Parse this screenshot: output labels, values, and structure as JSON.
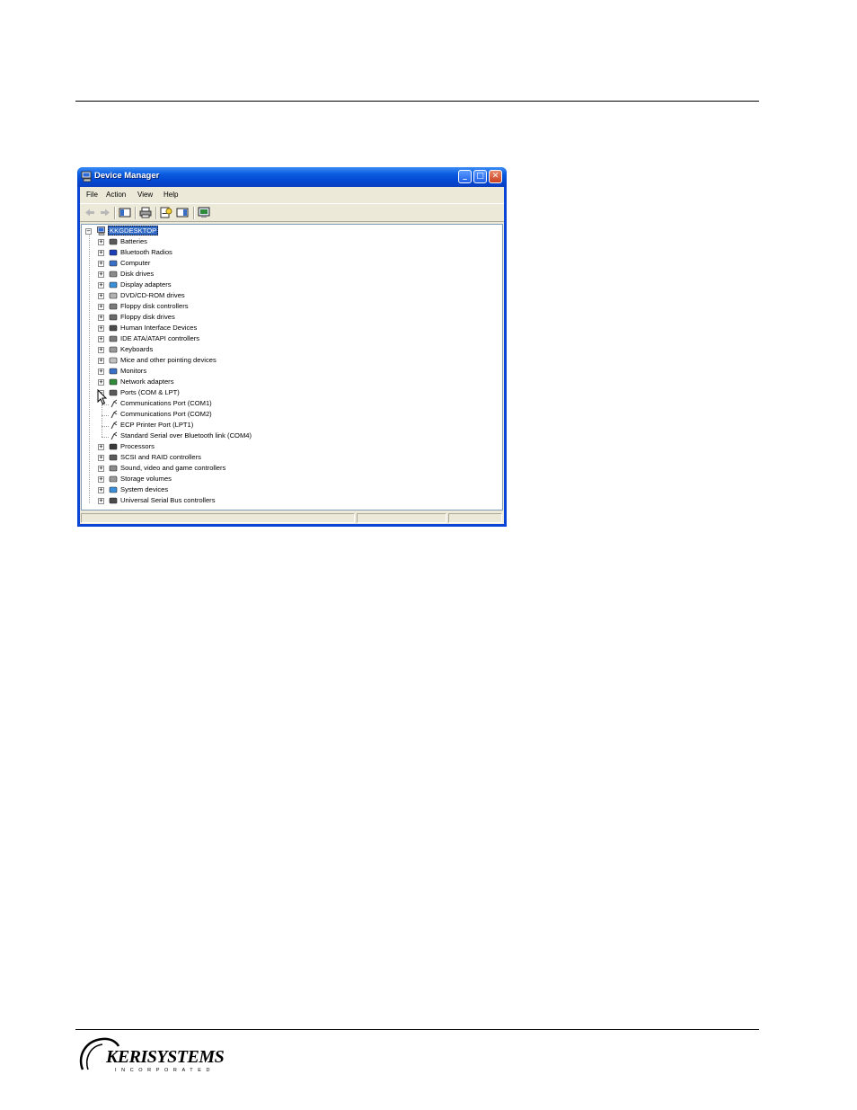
{
  "window": {
    "title": "Device Manager",
    "buttons": {
      "minimize": "_",
      "maximize": "□",
      "close": "✕"
    },
    "menu": [
      "File",
      "Action",
      "View",
      "Help"
    ],
    "toolbar_icons": [
      "back-arrow-icon",
      "forward-arrow-icon",
      "console-tree-icon",
      "print-icon",
      "properties-icon",
      "action-pane-icon",
      "scan-hardware-icon"
    ]
  },
  "tree": {
    "root": "KKGDESKTOP",
    "categories": [
      {
        "label": "Batteries",
        "icon": "battery-icon"
      },
      {
        "label": "Bluetooth Radios",
        "icon": "bluetooth-icon"
      },
      {
        "label": "Computer",
        "icon": "computer-icon"
      },
      {
        "label": "Disk drives",
        "icon": "disk-drive-icon"
      },
      {
        "label": "Display adapters",
        "icon": "display-adapter-icon"
      },
      {
        "label": "DVD/CD-ROM drives",
        "icon": "cdrom-icon"
      },
      {
        "label": "Floppy disk controllers",
        "icon": "floppy-controller-icon"
      },
      {
        "label": "Floppy disk drives",
        "icon": "floppy-drive-icon"
      },
      {
        "label": "Human Interface Devices",
        "icon": "hid-icon"
      },
      {
        "label": "IDE ATA/ATAPI controllers",
        "icon": "ide-controller-icon"
      },
      {
        "label": "Keyboards",
        "icon": "keyboard-icon"
      },
      {
        "label": "Mice and other pointing devices",
        "icon": "mouse-icon"
      },
      {
        "label": "Monitors",
        "icon": "monitor-icon"
      },
      {
        "label": "Network adapters",
        "icon": "network-adapter-icon"
      },
      {
        "label": "Ports (COM & LPT)",
        "icon": "port-icon"
      },
      {
        "label": "Processors",
        "icon": "processor-icon"
      },
      {
        "label": "SCSI and RAID controllers",
        "icon": "scsi-icon"
      },
      {
        "label": "Sound, video and game controllers",
        "icon": "sound-icon"
      },
      {
        "label": "Storage volumes",
        "icon": "storage-icon"
      },
      {
        "label": "System devices",
        "icon": "system-device-icon"
      },
      {
        "label": "Universal Serial Bus controllers",
        "icon": "usb-icon"
      }
    ],
    "ports_children": [
      "Communications Port (COM1)",
      "Communications Port (COM2)",
      "ECP Printer Port (LPT1)",
      "Standard Serial over Bluetooth link (COM4)"
    ]
  },
  "footer": {
    "logo_text": "KERISYSTEMS",
    "logo_subtext": "INCORPORATED"
  }
}
